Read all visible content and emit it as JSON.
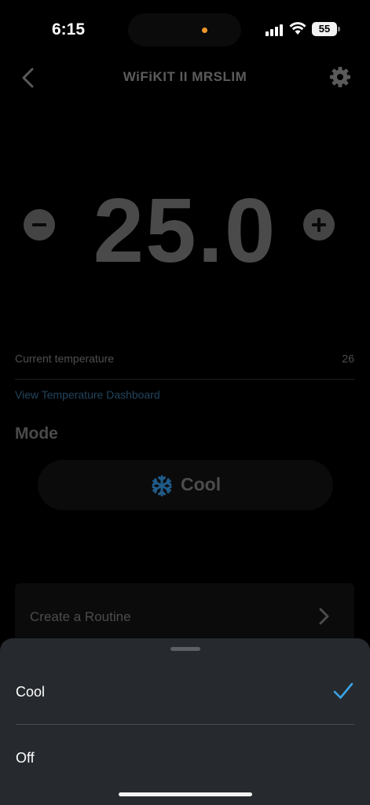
{
  "status_bar": {
    "time": "6:15",
    "battery": "55"
  },
  "header": {
    "title": "WiFiKIT II MRSLIM",
    "back_icon": "chevron-left-icon",
    "settings_icon": "gear-icon"
  },
  "thermostat": {
    "setpoint": "25.0",
    "decrease_icon": "minus-circle-icon",
    "increase_icon": "plus-circle-icon"
  },
  "info": {
    "current_temperature_label": "Current temperature",
    "current_temperature_value": "26",
    "dashboard_link": "View Temperature Dashboard"
  },
  "mode": {
    "heading": "Mode",
    "selected_label": "Cool",
    "icon": "snowflake-icon",
    "icon_color": "#1f5c8a"
  },
  "routine": {
    "label": "Create a Routine"
  },
  "sheet": {
    "options": [
      {
        "label": "Cool",
        "selected": true
      },
      {
        "label": "Off",
        "selected": false
      }
    ],
    "check_color": "#3ba3e6"
  }
}
